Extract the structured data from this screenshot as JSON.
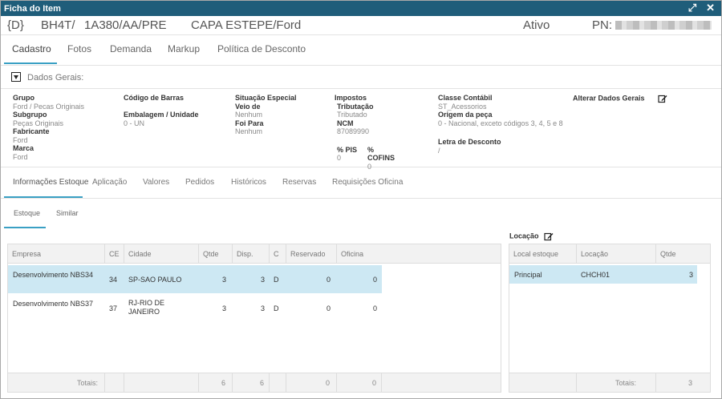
{
  "window": {
    "title": "Ficha do Item",
    "expand_icon": "expand-icon",
    "close_icon": "close-icon"
  },
  "header": {
    "code": "{D}",
    "ref1": "BH4T/",
    "ref2": "1A380/AA/PRE",
    "description": "CAPA ESTEPE/Ford",
    "status": "Ativo",
    "pn_label": "PN:"
  },
  "main_tabs": [
    "Cadastro",
    "Fotos",
    "Demanda",
    "Markup",
    "Política de Desconto"
  ],
  "dados_gerais": {
    "label": "Dados Gerais:"
  },
  "fields": {
    "grupo": {
      "label": "Grupo",
      "value": "Ford / Pecas Originais"
    },
    "subgrupo": {
      "label": "Subgrupo",
      "value": "Peças Originais"
    },
    "fabricante": {
      "label": "Fabricante",
      "value": "Ford"
    },
    "marca": {
      "label": "Marca",
      "value": "Ford"
    },
    "codigo_barras": {
      "label": "Código de Barras",
      "value": ""
    },
    "embalagem": {
      "label": "Embalagem / Unidade",
      "value": "0 - UN"
    },
    "situacao": {
      "label": "Situação Especial",
      "value": ""
    },
    "veio_de": {
      "label": "Veio de",
      "value": "Nenhum"
    },
    "foi_para": {
      "label": "Foi Para",
      "value": "Nenhum"
    },
    "impostos": {
      "label": "Impostos"
    },
    "tributacao": {
      "label": "Tributação",
      "value": "Tributado"
    },
    "ncm": {
      "label": "NCM",
      "value": "87089990"
    },
    "pis": {
      "label": "% PIS",
      "value": "0"
    },
    "cofins": {
      "label": "% COFINS",
      "value": "0"
    },
    "classe": {
      "label": "Classe Contábil",
      "value": "ST_Acessorios"
    },
    "origem": {
      "label": "Origem da peça",
      "value": "0 - Nacional, exceto códigos 3, 4, 5 e 8"
    },
    "letra": {
      "label": "Letra de Desconto",
      "value": "/"
    },
    "alterar": {
      "label": "Alterar Dados Gerais"
    }
  },
  "sub_tabs": [
    "Informações Estoque",
    "Aplicação",
    "Valores",
    "Pedidos",
    "Históricos",
    "Reservas",
    "Requisições Oficina"
  ],
  "estoque_tabs": [
    "Estoque",
    "Similar"
  ],
  "estoque_table": {
    "columns": [
      "Empresa",
      "CE",
      "Cidade",
      "Qtde",
      "Disp.",
      "C",
      "Reservado",
      "Oficina"
    ],
    "rows": [
      {
        "empresa": "Desenvolvimento NBS34",
        "ce": "34",
        "cidade": "SP-SAO PAULO",
        "qtde": "3",
        "disp": "3",
        "c": "D",
        "reservado": "0",
        "oficina": "0"
      },
      {
        "empresa": "Desenvolvimento NBS37",
        "ce": "37",
        "cidade": "RJ-RIO DE JANEIRO",
        "qtde": "3",
        "disp": "3",
        "c": "D",
        "reservado": "0",
        "oficina": "0"
      }
    ],
    "totals": {
      "label": "Totais:",
      "qtde": "6",
      "disp": "6",
      "reservado": "0",
      "oficina": "0"
    }
  },
  "locacao": {
    "title": "Locação",
    "columns": [
      "Local estoque",
      "Locação",
      "Qtde"
    ],
    "rows": [
      {
        "local": "Principal",
        "locacao": "CHCH01",
        "qtde": "3"
      }
    ],
    "totals": {
      "label": "Totais:",
      "qtde": "3"
    }
  },
  "colors": {
    "titlebar": "#1f5d7a",
    "accent": "#3aa0c4",
    "selected_row": "#cde8f3"
  }
}
